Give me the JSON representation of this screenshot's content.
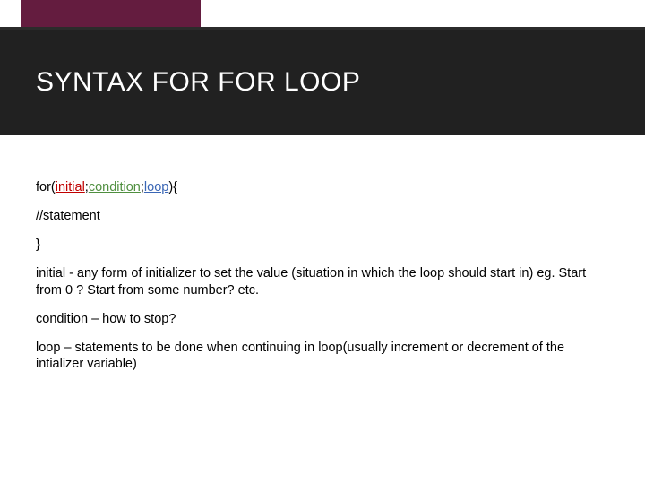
{
  "title": "SYNTAX FOR FOR LOOP",
  "syntax": {
    "for": "for(",
    "initial": "initial",
    "sep1": ";",
    "condition": "condition",
    "sep2": ";",
    "loop": "loop",
    "close": "){"
  },
  "lines": {
    "statement": "//statement",
    "brace": "}",
    "initial_desc": "initial -    any form of initializer to set the value (situation in which the loop should start in) eg. Start from 0 ? Start from some number? etc.",
    "condition_desc": "condition – how to stop?",
    "loop_desc": "loop – statements to be done when continuing in loop(usually increment or decrement of the intializer variable)"
  }
}
